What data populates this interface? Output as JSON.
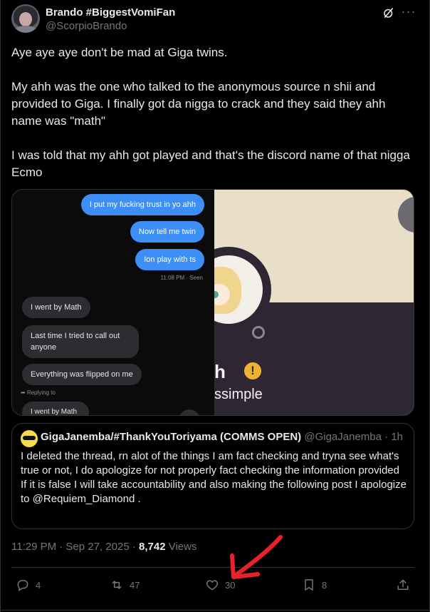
{
  "header": {
    "display_name": "Brando #BiggestVomiFan",
    "handle": "@ScorpioBrando"
  },
  "tweet": {
    "paragraphs": [
      "Aye aye aye don't be mad at Giga twins.",
      "My ahh was the one who talked to the anonymous source n shii and provided to Giga. I finally got da nigga to crack and they said they ahh name was \"math\"",
      "I was told that my ahh got played and that's the discord name of that nigga Ecmo"
    ]
  },
  "media": {
    "chat": {
      "outgoing": [
        "I put my fucking trust in yo ahh",
        "Now tell me twin",
        "Ion play with ts"
      ],
      "seen_label": "11:08 PM · Seen",
      "incoming": [
        "I went by Math",
        "Last time I tried to call out anyone",
        "Everything was flipped on me"
      ],
      "replying_label": "Replying to",
      "reply_context": "I went by Math"
    },
    "profile": {
      "name_fragment": "h",
      "warning_glyph": "!",
      "sub_fragment": "ssimple"
    }
  },
  "quote": {
    "name": "GigaJanemba/#ThankYouToriyama (COMMS OPEN)",
    "handle": "@GigaJanemba",
    "time": "1h",
    "text_lines": [
      "I deleted the thread, rn alot of the things I am fact checking and tryna see what's true or not, I do apologize for not properly fact checking the information provided",
      "If it is false I will take accountability and also making the following post I apologize to @Requiem_Diamond ."
    ]
  },
  "meta": {
    "timestamp": "11:29 PM · Sep 27, 2025 · ",
    "views_count": "8,742",
    "views_label": " Views"
  },
  "actions": {
    "replies": "4",
    "reposts": "47",
    "likes": "30",
    "bookmarks": "8"
  },
  "icons": {
    "grok": "grok-icon",
    "more": "more-icon",
    "reply": "reply-icon",
    "repost": "repost-icon",
    "like": "heart-icon",
    "bookmark": "bookmark-icon",
    "share": "share-icon"
  },
  "colors": {
    "background": "#000000",
    "text": "#e7e9ea",
    "muted": "#71767b",
    "border": "#2f3336",
    "bubble_blue": "#3d8ef7",
    "annotation_arrow": "#e8212b"
  }
}
